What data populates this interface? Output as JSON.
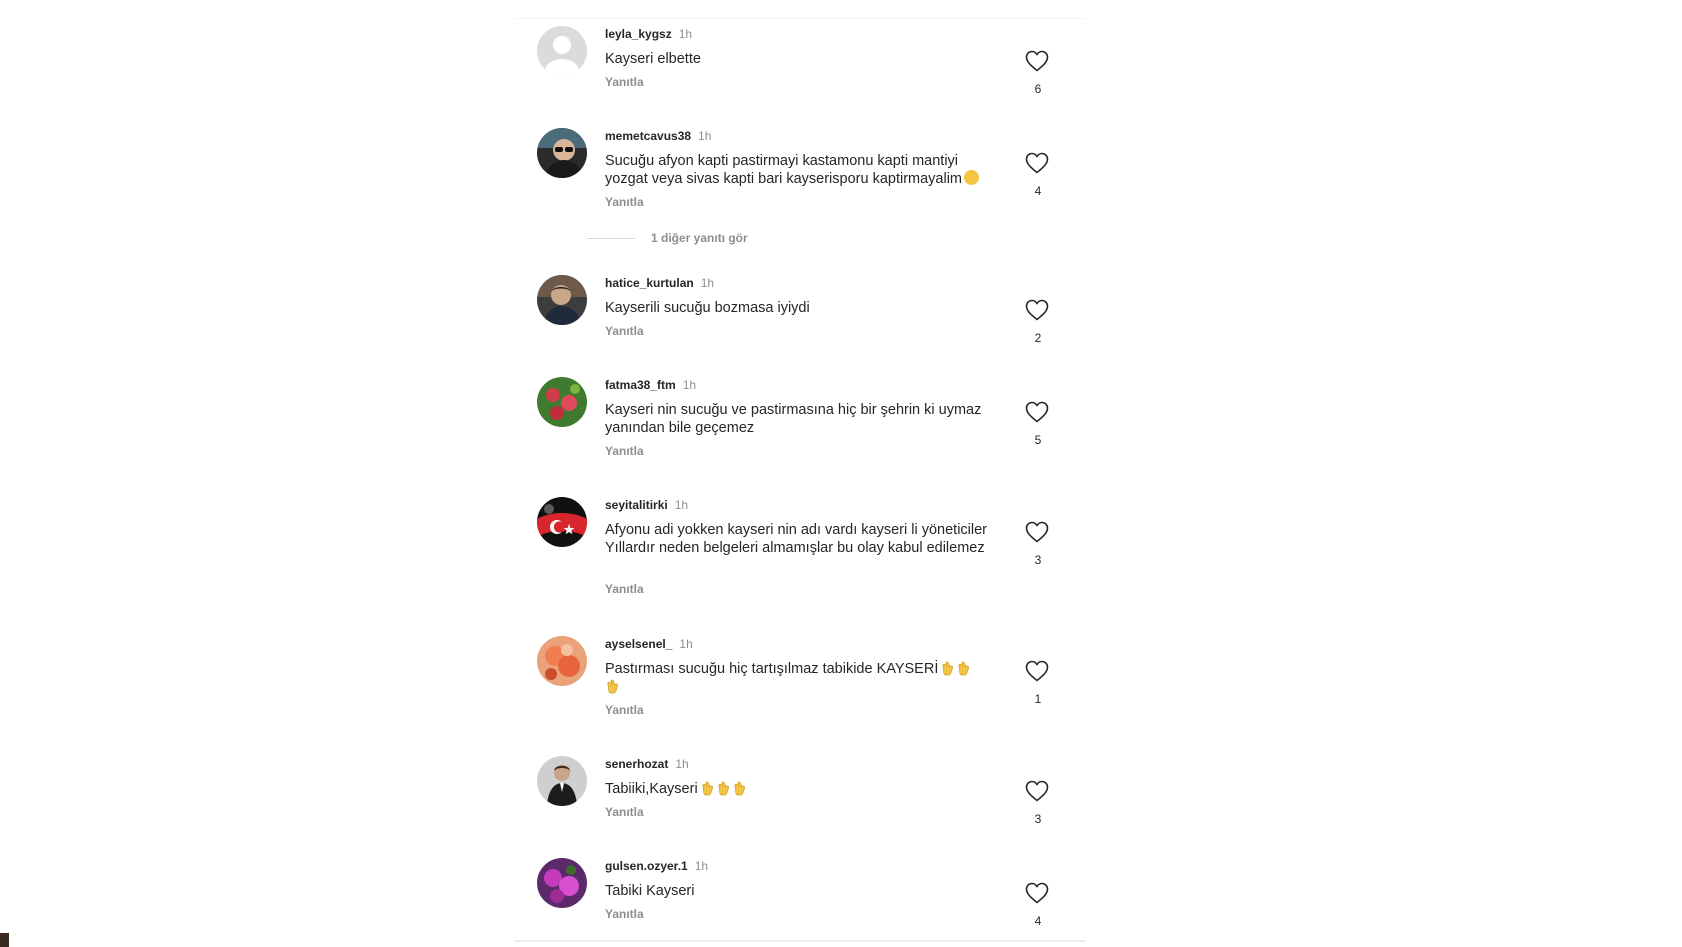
{
  "comments": [
    {
      "username": "leyla_kygsz",
      "time": "1h",
      "text": "Kayseri elbette",
      "emoji": "",
      "reply": "Yanıtla",
      "likes": "6",
      "avatar": "default-avatar"
    },
    {
      "username": "memetcavus38",
      "time": "1h",
      "text": "Sucuğu afyon kapti pastirmayi kastamonu kapti mantiyi yozgat veya sivas kapti bari kayserisporu kaptirmayalim",
      "emoji": "laughing-emoji",
      "reply": "Yanıtla",
      "likes": "4",
      "avatar": "man-with-glasses-avatar"
    },
    {
      "username": "hatice_kurtulan",
      "time": "1h",
      "text": "Kayserili sucuğu bozmasa iyiydi",
      "emoji": "",
      "reply": "Yanıtla",
      "likes": "2",
      "avatar": "person-avatar"
    },
    {
      "username": "fatma38_ftm",
      "time": "1h",
      "text": "Kayseri nin sucuğu ve pastirmasına hiç bir şehrin ki uymaz yanından bile geçemez",
      "emoji": "",
      "reply": "Yanıtla",
      "likes": "5",
      "avatar": "flowers-avatar"
    },
    {
      "username": "seyitalitirki",
      "time": "1h",
      "text": "Afyonu adi yokken  kayseri nin adı vardı  kayseri li yöneticiler Yıllardır  neden belgeleri almamışlar bu olay kabul edilemez",
      "emoji": "",
      "reply": "Yanıtla",
      "likes": "3",
      "avatar": "turkish-flag-avatar"
    },
    {
      "username": "ayselsenel_",
      "time": "1h",
      "text": "Pastırması  sucuğu hiç tartışılmaz tabikide KAYSERİ",
      "emoji": "clap-emoji x3",
      "reply": "Yanıtla",
      "likes": "1",
      "avatar": "peach-flower-avatar"
    },
    {
      "username": "senerhozat",
      "time": "1h",
      "text": "Tabiiki,Kayseri",
      "emoji": "clap-emoji x3",
      "reply": "Yanıtla",
      "likes": "3",
      "avatar": "man-in-suit-avatar"
    },
    {
      "username": "gulsen.ozyer.1",
      "time": "1h",
      "text": "Tabiki Kayseri",
      "emoji": "",
      "reply": "Yanıtla",
      "likes": "4",
      "avatar": "purple-flowers-avatar"
    }
  ],
  "more_replies": {
    "label": "1 diğer yanıtı gör"
  },
  "colors": {
    "text": "#262626",
    "muted": "#8e8e8e",
    "background": "#ffffff"
  },
  "icons": {
    "like": "heart-outline-icon"
  }
}
